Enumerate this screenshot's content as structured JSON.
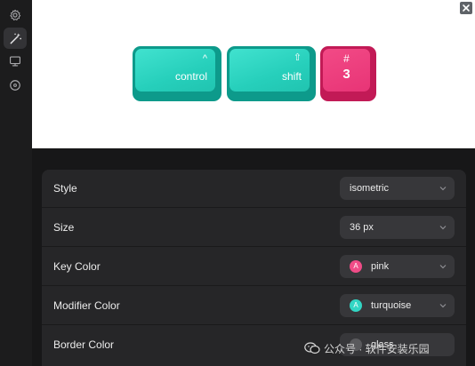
{
  "sidebar": {
    "items": [
      {
        "icon": "gear-icon",
        "active": false
      },
      {
        "icon": "magic-wand-icon",
        "active": true
      },
      {
        "icon": "monitor-icon",
        "active": false
      },
      {
        "icon": "disc-icon",
        "active": false
      }
    ]
  },
  "preview": {
    "keys": [
      {
        "symbol": "^",
        "label": "control",
        "color": "turquoise"
      },
      {
        "symbol": "⇧",
        "label": "shift",
        "color": "turquoise"
      },
      {
        "symbol": "#",
        "label": "3",
        "color": "pink"
      }
    ]
  },
  "settings": {
    "rows": [
      {
        "label": "Style",
        "value": "isometric"
      },
      {
        "label": "Size",
        "value": "36 px"
      },
      {
        "label": "Key Color",
        "value": "pink",
        "swatch_letter": "A",
        "swatch_color": "#f04c87"
      },
      {
        "label": "Modifier Color",
        "value": "turquoise",
        "swatch_letter": "A",
        "swatch_color": "#32d6c4"
      },
      {
        "label": "Border Color",
        "value": "glass",
        "swatch_letter": "",
        "swatch_color": "#5a5a5d"
      }
    ]
  },
  "watermark": {
    "text": "公众号 · 软件安装乐园"
  },
  "colors": {
    "turquoise": "#2ad2be",
    "pink": "#ea3a7b",
    "panel": "#262628",
    "select": "#37373a"
  }
}
